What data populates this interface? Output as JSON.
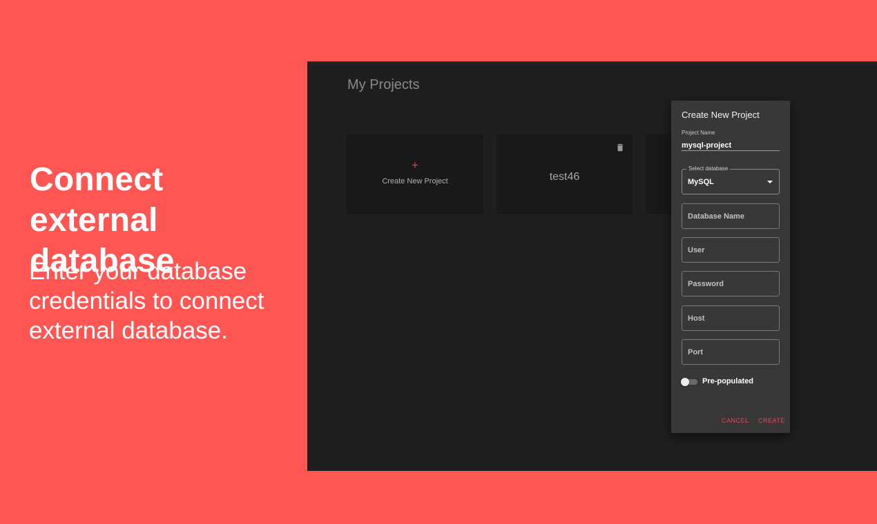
{
  "promo": {
    "heading": "Connect external database",
    "subtext": "Enter your database credentials to connect external database."
  },
  "app": {
    "page_title": "My Projects",
    "cards": {
      "new_project": {
        "icon": "+",
        "label": "Create New Project"
      },
      "project": {
        "name": "test46"
      }
    }
  },
  "dialog": {
    "title": "Create New Project",
    "project_name": {
      "label": "Project Name",
      "value": "mysql-project"
    },
    "select_database": {
      "label": "Select database",
      "value": "MySQL"
    },
    "fields": {
      "database_name": "Database Name",
      "user": "User",
      "password": "Password",
      "host": "Host",
      "port": "Port"
    },
    "pre_populated": {
      "label": "Pre-populated",
      "enabled": false
    },
    "buttons": {
      "cancel": "CANCEL",
      "create": "CREATE"
    }
  },
  "colors": {
    "background": "#ff5654",
    "app_background": "#1f1f1f",
    "card": "#191919",
    "dialog": "#383838",
    "accent": "#e8494b"
  },
  "icons": [
    "delete-icon",
    "plus-icon",
    "dropdown-arrow-icon"
  ]
}
